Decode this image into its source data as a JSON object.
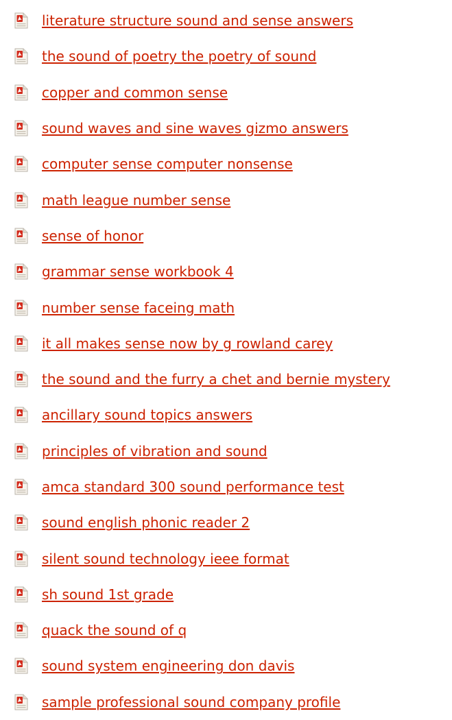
{
  "links": [
    {
      "label": "literature structure sound and sense answers",
      "icon": "pdf-file-icon"
    },
    {
      "label": "the sound of poetry the poetry of sound",
      "icon": "pdf-file-icon"
    },
    {
      "label": "copper and common sense",
      "icon": "pdf-file-icon"
    },
    {
      "label": "sound waves and sine waves gizmo answers",
      "icon": "pdf-file-icon"
    },
    {
      "label": "computer sense computer nonsense",
      "icon": "pdf-file-icon"
    },
    {
      "label": "math league number sense",
      "icon": "pdf-file-icon"
    },
    {
      "label": "sense of honor",
      "icon": "pdf-file-icon"
    },
    {
      "label": "grammar sense workbook 4",
      "icon": "pdf-file-icon"
    },
    {
      "label": "number sense faceing math",
      "icon": "pdf-file-icon"
    },
    {
      "label": "it all makes sense now by g rowland carey",
      "icon": "pdf-file-icon"
    },
    {
      "label": "the sound and the furry a chet and bernie mystery",
      "icon": "pdf-file-icon"
    },
    {
      "label": "ancillary sound topics answers",
      "icon": "pdf-file-icon"
    },
    {
      "label": "principles of vibration and sound",
      "icon": "pdf-file-icon"
    },
    {
      "label": "amca standard 300 sound performance test",
      "icon": "pdf-file-icon"
    },
    {
      "label": "sound english phonic reader 2",
      "icon": "pdf-file-icon"
    },
    {
      "label": "silent sound technology ieee format",
      "icon": "pdf-file-icon"
    },
    {
      "label": "sh sound 1st grade",
      "icon": "pdf-file-icon"
    },
    {
      "label": "quack the sound of q",
      "icon": "pdf-file-icon"
    },
    {
      "label": "sound system engineering don davis",
      "icon": "pdf-file-icon"
    },
    {
      "label": "sample professional sound company profile",
      "icon": "pdf-file-icon"
    }
  ],
  "colors": {
    "link": "#cc2200",
    "pdf_red": "#d32d1e",
    "page_bg": "#ffffff"
  }
}
